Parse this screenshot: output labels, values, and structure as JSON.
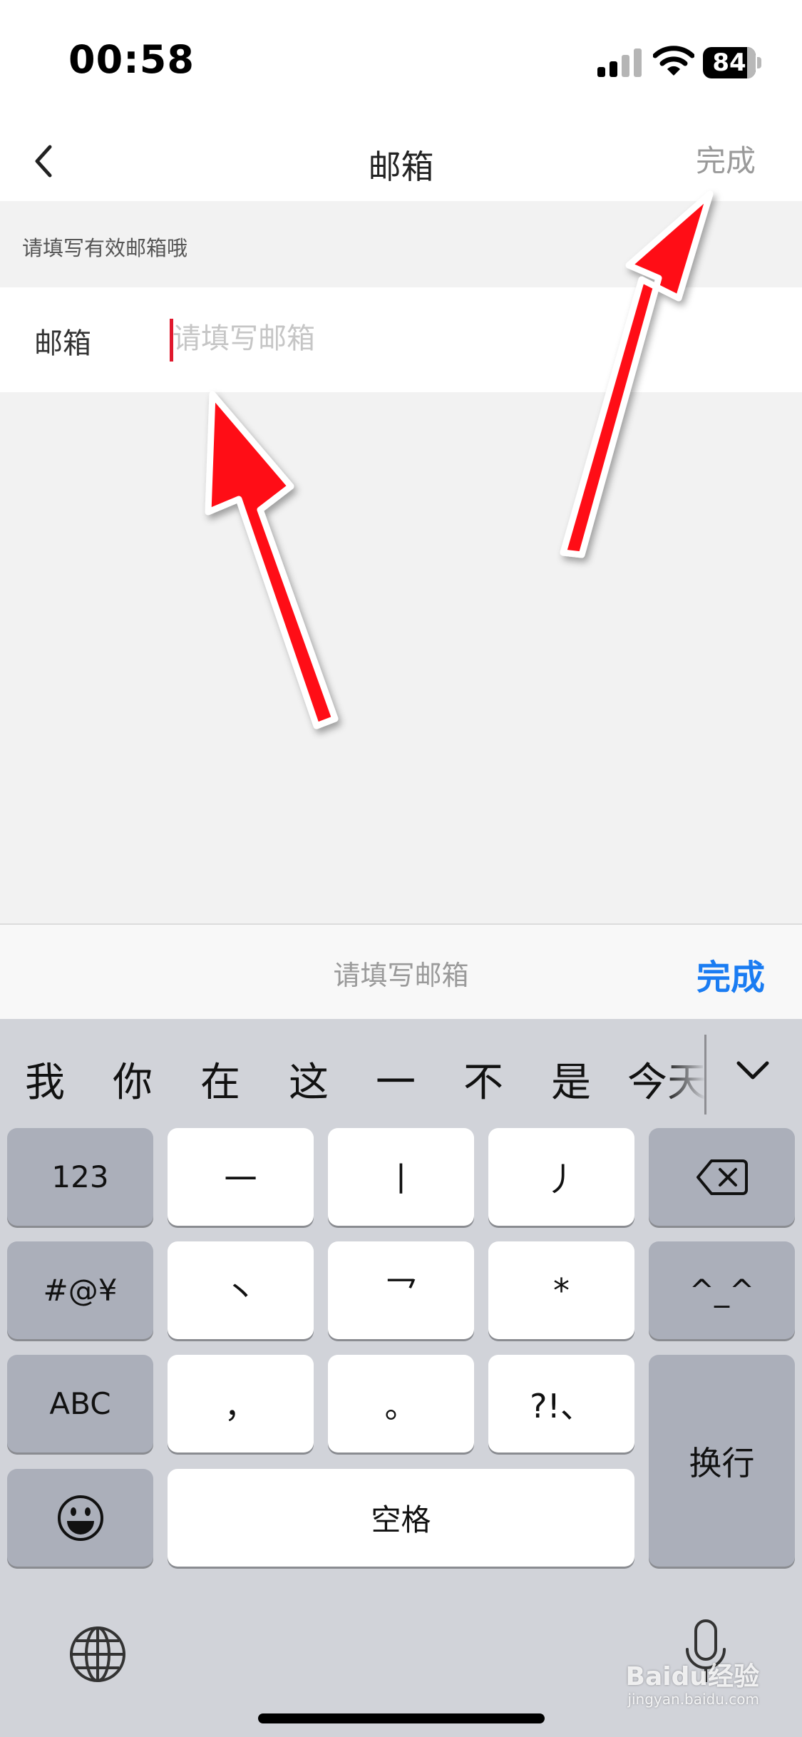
{
  "status_bar": {
    "time": "00:58",
    "battery_level": "84",
    "signal_bars_filled": 2,
    "signal_bars_total": 4
  },
  "nav": {
    "title": "邮箱",
    "done_label": "完成"
  },
  "form": {
    "hint": "请填写有效邮箱哦",
    "email_label": "邮箱",
    "email_value": "",
    "email_placeholder": "请填写邮箱"
  },
  "keyboard_accessory": {
    "placeholder": "请填写邮箱",
    "done_label": "完成"
  },
  "keyboard": {
    "candidates": [
      "我",
      "你",
      "在",
      "这",
      "一",
      "不",
      "是",
      "今天"
    ],
    "keys": {
      "numbers": "123",
      "stroke_heng": "一",
      "stroke_shu": "丨",
      "stroke_pie": "丿",
      "symbols": "#@¥",
      "stroke_dian": "丶",
      "stroke_zhe": "乛",
      "wildcard": "*",
      "emoticon": "^_^",
      "abc": "ABC",
      "comma": "，",
      "period": "。",
      "punct": "?!、",
      "return": "换行",
      "space": "空格"
    }
  },
  "watermark": {
    "brand": "Baidu经验",
    "url": "jingyan.baidu.com"
  },
  "colors": {
    "accent_blue": "#1a7cf2",
    "cursor_red": "#e0182d",
    "annotation_red": "#ff0a14"
  }
}
